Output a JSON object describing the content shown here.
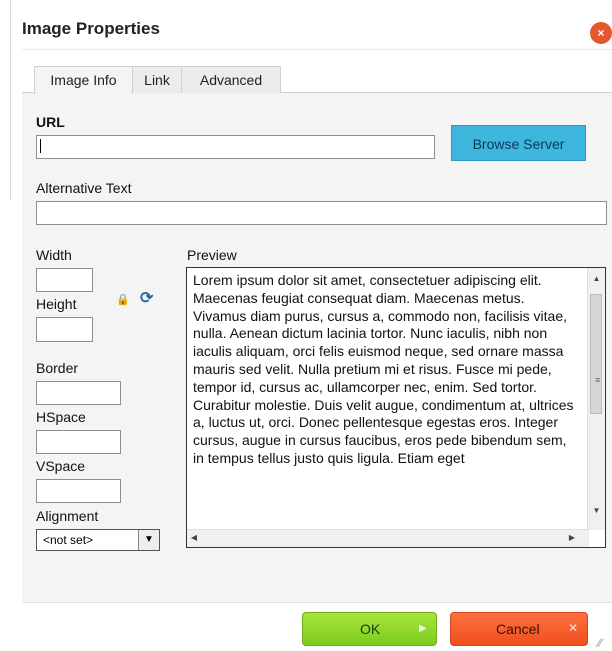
{
  "dialog": {
    "title": "Image Properties",
    "close_icon": "×"
  },
  "tabs": [
    {
      "label": "Image Info",
      "active": true
    },
    {
      "label": "Link",
      "active": false
    },
    {
      "label": "Advanced",
      "active": false
    }
  ],
  "url": {
    "label": "URL",
    "value": ""
  },
  "browse_server_label": "Browse Server",
  "alt_text": {
    "label": "Alternative Text",
    "value": ""
  },
  "fields": {
    "width": {
      "label": "Width",
      "value": ""
    },
    "height": {
      "label": "Height",
      "value": ""
    },
    "border": {
      "label": "Border",
      "value": ""
    },
    "hspace": {
      "label": "HSpace",
      "value": ""
    },
    "vspace": {
      "label": "VSpace",
      "value": ""
    }
  },
  "icons": {
    "lock": "lock-icon",
    "reset": "reset-size-icon"
  },
  "alignment": {
    "label": "Alignment",
    "selected": "<not set>"
  },
  "preview": {
    "label": "Preview",
    "text": "Lorem ipsum dolor sit amet, consectetuer adipiscing elit. Maecenas feugiat consequat diam. Maecenas metus. Vivamus diam purus, cursus a, commodo non, facilisis vitae, nulla. Aenean dictum lacinia tortor. Nunc iaculis, nibh non iaculis aliquam, orci felis euismod neque, sed ornare massa mauris sed velit. Nulla pretium mi et risus. Fusce mi pede, tempor id, cursus ac, ullamcorper nec, enim. Sed tortor. Curabitur molestie. Duis velit augue, condimentum at, ultrices a, luctus ut, orci. Donec pellentesque egestas eros. Integer cursus, augue in cursus faucibus, eros pede bibendum sem, in tempus tellus justo quis ligula. Etiam eget"
  },
  "buttons": {
    "ok": "OK",
    "cancel": "Cancel"
  },
  "colors": {
    "ok": "#8fd92c",
    "cancel": "#f55a28",
    "browse": "#3db5dd",
    "close": "#e5572c"
  }
}
